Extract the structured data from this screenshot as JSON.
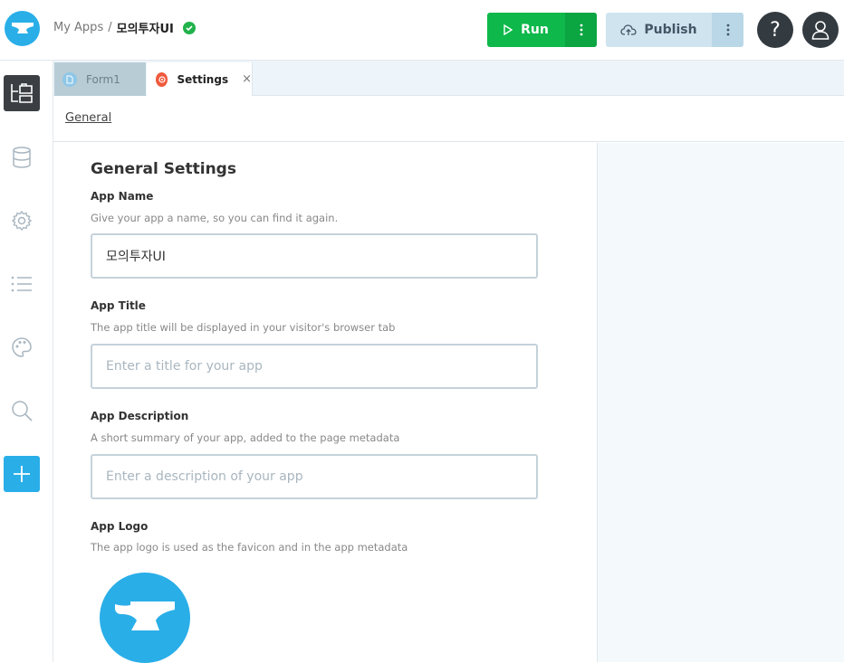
{
  "header": {
    "breadcrumb_parent": "My Apps",
    "breadcrumb_sep": "/",
    "app_name": "모의투자UI",
    "run_label": "Run",
    "publish_label": "Publish",
    "help_label": "?"
  },
  "tabs": [
    {
      "label": "Form1",
      "active": false
    },
    {
      "label": "Settings",
      "active": true,
      "close": "×"
    }
  ],
  "subnav": {
    "general_label": "General"
  },
  "settings": {
    "title": "General Settings",
    "app_name": {
      "label": "App Name",
      "help": "Give your app a name, so you can find it again.",
      "value": "모의투자UI"
    },
    "app_title": {
      "label": "App Title",
      "help": "The app title will be displayed in your visitor's browser tab",
      "placeholder": "Enter a title for your app"
    },
    "app_description": {
      "label": "App Description",
      "help": "A short summary of your app, added to the page metadata",
      "placeholder": "Enter a description of your app"
    },
    "app_logo": {
      "label": "App Logo",
      "help": "The app logo is used as the favicon and in the app metadata"
    }
  },
  "rail": [
    "app-tree-icon",
    "database-icon",
    "gear-icon",
    "list-icon",
    "palette-icon",
    "search-icon",
    "plus-icon"
  ],
  "colors": {
    "brand": "#29aee8",
    "run_green": "#0eb84a",
    "publish_bg": "#cfe4ef",
    "status_ok": "#21b24b",
    "settings_tab_icon": "#f05a3d"
  }
}
